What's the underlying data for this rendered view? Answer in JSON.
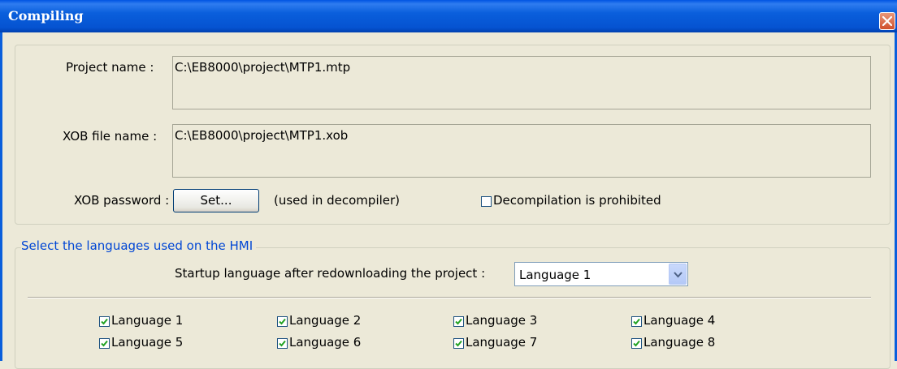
{
  "window": {
    "title": "Compiling"
  },
  "project": {
    "label": "Project name :",
    "value": "C:\\EB8000\\project\\MTP1.mtp"
  },
  "xob_file": {
    "label": "XOB file name :",
    "value": "C:\\EB8000\\project\\MTP1.xob"
  },
  "xob_password": {
    "label": "XOB password :",
    "button_label": "Set...",
    "note": "(used in decompiler)"
  },
  "decompilation": {
    "label": "Decompilation is prohibited",
    "checked": false
  },
  "languages": {
    "group_title": "Select the languages used on the HMI",
    "startup_label": "Startup language after redownloading the project :",
    "startup_value": "Language 1",
    "items": [
      {
        "label": "Language 1",
        "checked": true
      },
      {
        "label": "Language 2",
        "checked": true
      },
      {
        "label": "Language 3",
        "checked": true
      },
      {
        "label": "Language 4",
        "checked": true
      },
      {
        "label": "Language 5",
        "checked": true
      },
      {
        "label": "Language 6",
        "checked": true
      },
      {
        "label": "Language 7",
        "checked": true
      },
      {
        "label": "Language 8",
        "checked": true
      }
    ]
  },
  "icons": {
    "close": "close-icon",
    "dropdown": "chevron-down-icon",
    "check": "checkmark-icon"
  },
  "colors": {
    "titlebar": "#0a5fdc",
    "group_caption": "#0046d5",
    "window_bg": "#ece9d8"
  }
}
